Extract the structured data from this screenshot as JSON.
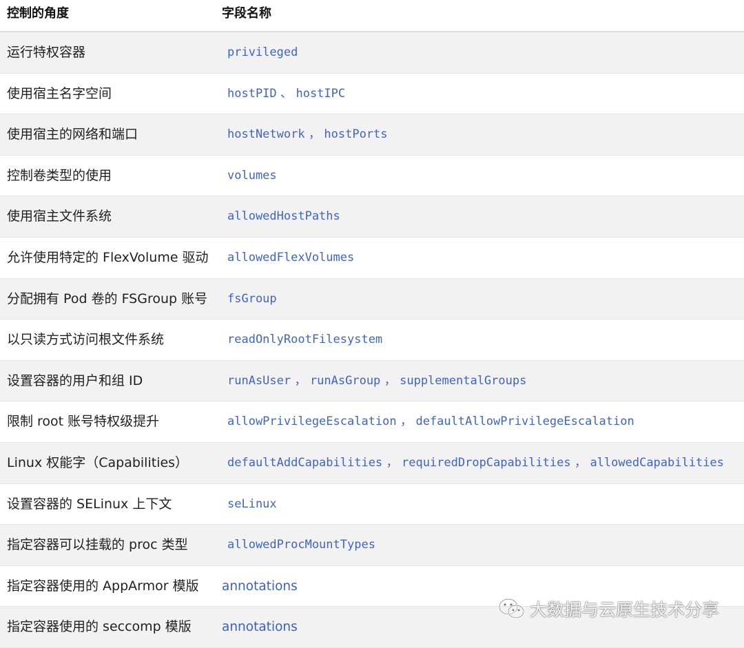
{
  "header": {
    "col1": "控制的角度",
    "col2": "字段名称"
  },
  "rows": [
    {
      "aspect": "运行特权容器",
      "fields": [
        "privileged"
      ]
    },
    {
      "aspect": "使用宿主名字空间",
      "fields": [
        "hostPID",
        "hostIPC"
      ],
      "separator": " 、 "
    },
    {
      "aspect": "使用宿主的网络和端口",
      "fields": [
        "hostNetwork",
        "hostPorts"
      ],
      "separator": " ， "
    },
    {
      "aspect": "控制卷类型的使用",
      "fields": [
        "volumes"
      ]
    },
    {
      "aspect": "使用宿主文件系统",
      "fields": [
        "allowedHostPaths"
      ]
    },
    {
      "aspect": "允许使用特定的 FlexVolume 驱动",
      "fields": [
        "allowedFlexVolumes"
      ]
    },
    {
      "aspect": "分配拥有 Pod 卷的 FSGroup 账号",
      "fields": [
        "fsGroup"
      ]
    },
    {
      "aspect": "以只读方式访问根文件系统",
      "fields": [
        "readOnlyRootFilesystem"
      ]
    },
    {
      "aspect": "设置容器的用户和组 ID",
      "fields": [
        "runAsUser",
        "runAsGroup",
        "supplementalGroups"
      ],
      "separator": " ， "
    },
    {
      "aspect": "限制 root 账号特权级提升",
      "fields": [
        "allowPrivilegeEscalation",
        "defaultAllowPrivilegeEscalation"
      ],
      "separator": " ， "
    },
    {
      "aspect": "Linux 权能字（Capabilities）",
      "fields": [
        "defaultAddCapabilities",
        "requiredDropCapabilities",
        "allowedCapabilities"
      ],
      "separator": " ， "
    },
    {
      "aspect": "设置容器的 SELinux 上下文",
      "fields": [
        "seLinux"
      ]
    },
    {
      "aspect": "指定容器可以挂载的 proc 类型",
      "fields": [
        "allowedProcMountTypes"
      ]
    },
    {
      "aspect": "指定容器使用的 AppArmor 模版",
      "fields": [
        "annotations"
      ],
      "plain": true
    },
    {
      "aspect": "指定容器使用的 seccomp 模版",
      "fields": [
        "annotations"
      ],
      "plain": true
    }
  ],
  "watermark": {
    "text": "大数据与云原生技术分享",
    "icon": "wechat-icon"
  },
  "colors": {
    "field_text": "#3f64c8",
    "stripe": "#f2f2f2"
  }
}
